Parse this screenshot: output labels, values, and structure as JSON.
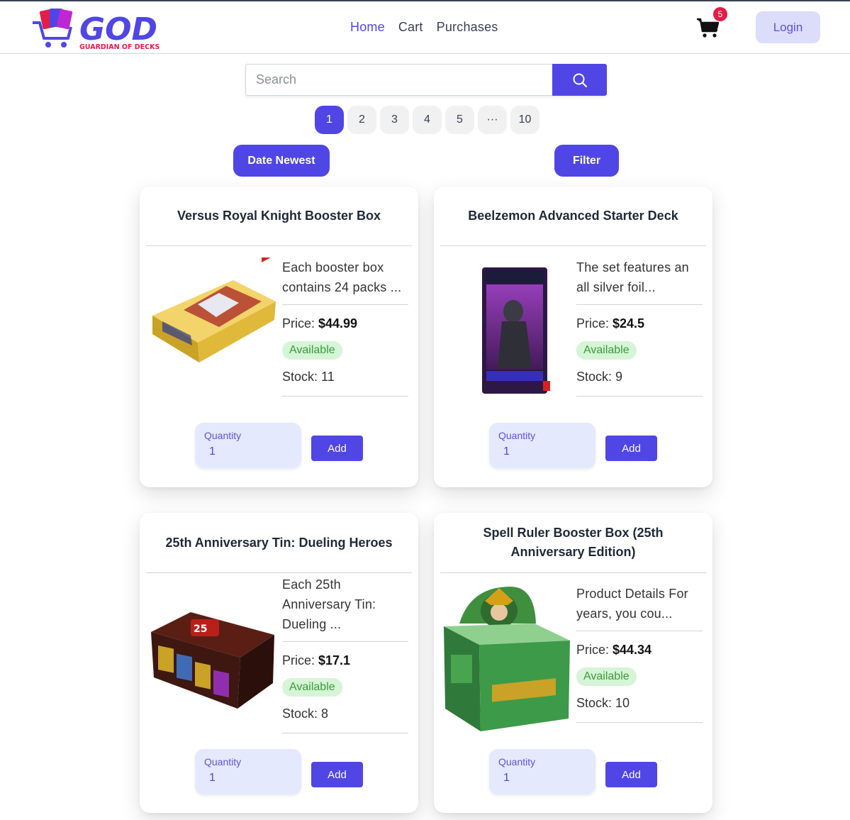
{
  "header": {
    "logo_text": "GOD",
    "logo_subtitle": "GUARDIAN OF DECKS",
    "nav": [
      "Home",
      "Cart",
      "Purchases"
    ],
    "active_nav": "Home",
    "cart_count": "5",
    "login_label": "Login"
  },
  "search": {
    "placeholder": "Search",
    "value": ""
  },
  "pagination": [
    "1",
    "2",
    "3",
    "4",
    "5",
    "···",
    "10"
  ],
  "current_page": "1",
  "controls": {
    "sort_label": "Date Newest",
    "filter_label": "Filter"
  },
  "labels": {
    "price": "Price: ",
    "stock": "Stock: ",
    "quantity": "Quantity",
    "add": "Add"
  },
  "products": [
    {
      "title": "Versus Royal Knight Booster Box",
      "description": "Each booster box contains 24 packs ...",
      "price": "$44.99",
      "status": "Available",
      "stock": "11",
      "quantity": "1"
    },
    {
      "title": "Beelzemon Advanced Starter Deck",
      "description": "The set features an all silver foil...",
      "price": "$24.5",
      "status": "Available",
      "stock": "9",
      "quantity": "1"
    },
    {
      "title": "25th Anniversary Tin: Dueling Heroes",
      "description": "Each 25th Anniversary Tin: Dueling ...",
      "price": "$17.1",
      "status": "Available",
      "stock": "8",
      "quantity": "1"
    },
    {
      "title": "Spell Ruler Booster Box (25th Anniversary Edition)",
      "description": "Product Details For years, you cou...",
      "price": "$44.34",
      "status": "Available",
      "stock": "10",
      "quantity": "1"
    }
  ],
  "colors": {
    "accent": "#5046e5",
    "available_bg": "#d6f5d6",
    "available_text": "#3a9a3a",
    "badge": "#e11d48"
  }
}
